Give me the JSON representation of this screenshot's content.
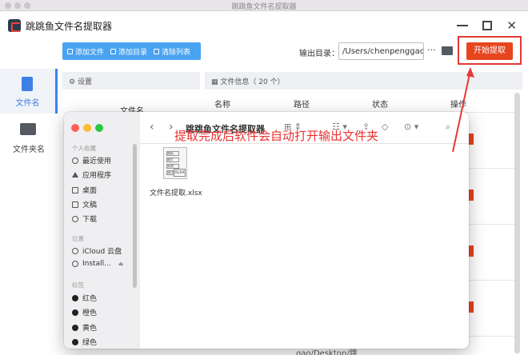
{
  "window": {
    "title": "跳跳鱼文件名提取器"
  },
  "app": {
    "name": "跳跳鱼文件名提取器"
  },
  "nav": [
    {
      "label": "文件名",
      "icon": "file-icon",
      "active": true
    },
    {
      "label": "文件夹名",
      "icon": "folder-icon",
      "active": false
    }
  ],
  "toolbar": {
    "add_file": "添加文件",
    "add_dir": "添加目录",
    "clear_list": "清除列表",
    "output_label": "输出目录：",
    "output_path": "/Users/chenpenggao/D",
    "more": "···",
    "start": "开始提取"
  },
  "settings": {
    "title": "设置",
    "sub": "文件名"
  },
  "file_info": {
    "title": "文件信息（ 20 个）",
    "columns": [
      "名称",
      "路径",
      "状态",
      "操作"
    ]
  },
  "background_path_fragment": "gao/Desktop/跳",
  "finder": {
    "title": "跳跳鱼文件名提取器",
    "sections": [
      {
        "heading": "个人收藏",
        "items": [
          {
            "label": "最近使用",
            "icon": "clock-icon"
          },
          {
            "label": "应用程序",
            "icon": "apps-icon"
          },
          {
            "label": "桌面",
            "icon": "desktop-icon"
          },
          {
            "label": "文稿",
            "icon": "document-icon"
          },
          {
            "label": "下载",
            "icon": "download-icon"
          }
        ]
      },
      {
        "heading": "位置",
        "items": [
          {
            "label": "iCloud 云盘",
            "icon": "cloud-icon"
          },
          {
            "label": "Install...",
            "icon": "disk-icon"
          }
        ]
      },
      {
        "heading": "标签",
        "items": [
          {
            "label": "红色",
            "icon": "tag-dot-icon"
          },
          {
            "label": "橙色",
            "icon": "tag-dot-icon"
          },
          {
            "label": "黄色",
            "icon": "tag-dot-icon"
          },
          {
            "label": "绿色",
            "icon": "tag-dot-icon"
          }
        ]
      }
    ],
    "file": {
      "name": "文件名提取.xlsx",
      "thumb_lines": [
        "图标",
        "图片",
        "失败",
        "成功"
      ],
      "thumb_badge": "XLSX"
    }
  },
  "annotation": "提取完成后软件会自动打开输出文件夹",
  "colors": {
    "accent_blue": "#4aa3f0",
    "start_red": "#e8451f",
    "annotation_red": "#ec3030",
    "traffic_red": "#fe5f57",
    "traffic_yellow": "#febc2e",
    "traffic_green": "#28c840"
  }
}
